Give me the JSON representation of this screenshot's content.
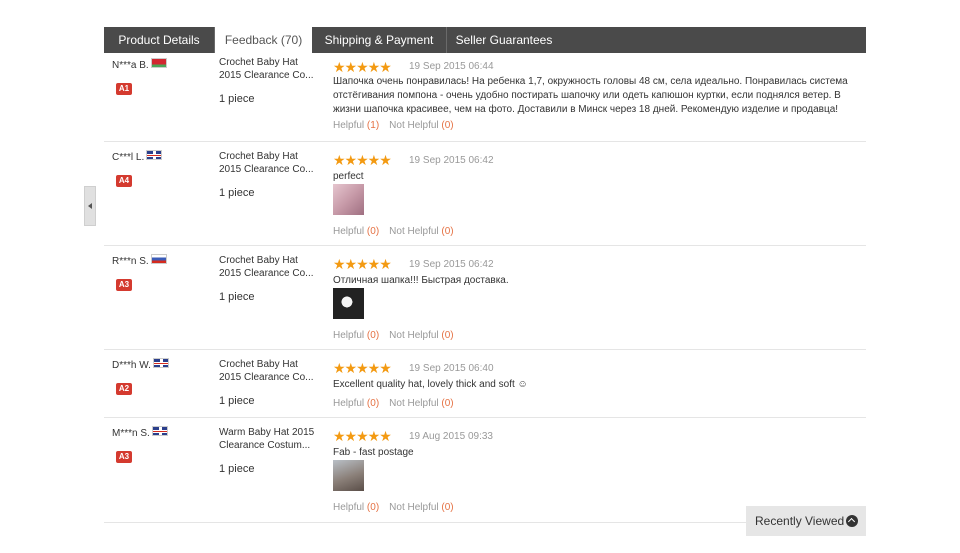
{
  "tabs": [
    {
      "label": "Product Details"
    },
    {
      "label": "Feedback (70)"
    },
    {
      "label": "Shipping & Payment"
    },
    {
      "label": "Seller Guarantees"
    }
  ],
  "reviews": [
    {
      "buyer": "N***a B.",
      "flag": "by",
      "level": "A1",
      "product": "Crochet Baby Hat 2015 Clearance Co...",
      "quantity": "1 piece",
      "stars": "★★★★★",
      "date": "19 Sep 2015 06:44",
      "text": "Шапочка очень понравилась! На ребенка 1,7, окружность головы 48 см, села идеально. Понравилась система отстёгивания помпона - очень удобно постирать шапочку или одеть капюшон куртки, если поднялся ветер. В жизни шапочка красивее, чем на фото. Доставили в Минск через 18 дней. Рекомендую изделие и продавца!",
      "helpful_label": "Helpful",
      "helpful_count": "(1)",
      "not_helpful_label": "Not Helpful",
      "not_helpful_count": "(0)"
    },
    {
      "buyer": "C***l L.",
      "flag": "gb",
      "level": "A4",
      "product": "Crochet Baby Hat 2015 Clearance Co...",
      "quantity": "1 piece",
      "stars": "★★★★★",
      "date": "19 Sep 2015 06:42",
      "text": "perfect",
      "helpful_label": "Helpful",
      "helpful_count": "(0)",
      "not_helpful_label": "Not Helpful",
      "not_helpful_count": "(0)"
    },
    {
      "buyer": "R***n S.",
      "flag": "ru",
      "level": "A3",
      "product": "Crochet Baby Hat 2015 Clearance Co...",
      "quantity": "1 piece",
      "stars": "★★★★★",
      "date": "19 Sep 2015 06:42",
      "text": "Отличная шапка!!! Быстрая доставка.",
      "helpful_label": "Helpful",
      "helpful_count": "(0)",
      "not_helpful_label": "Not Helpful",
      "not_helpful_count": "(0)"
    },
    {
      "buyer": "D***h W.",
      "flag": "gb",
      "level": "A2",
      "product": "Crochet Baby Hat 2015 Clearance Co...",
      "quantity": "1 piece",
      "stars": "★★★★★",
      "date": "19 Sep 2015 06:40",
      "text": "Excellent quality hat, lovely thick and soft ☺",
      "helpful_label": "Helpful",
      "helpful_count": "(0)",
      "not_helpful_label": "Not Helpful",
      "not_helpful_count": "(0)"
    },
    {
      "buyer": "M***n S.",
      "flag": "gb",
      "level": "A3",
      "product": "Warm Baby Hat 2015 Clearance Costum...",
      "quantity": "1 piece",
      "stars": "★★★★★",
      "date": "19 Aug 2015 09:33",
      "text": "Fab - fast postage",
      "helpful_label": "Helpful",
      "helpful_count": "(0)",
      "not_helpful_label": "Not Helpful",
      "not_helpful_count": "(0)"
    }
  ],
  "recently_viewed": {
    "label": "Recently Viewed",
    "icon": "chevron-up-circle-icon"
  },
  "colors": {
    "tab_bar": "#4a4a4a",
    "star": "#f39a12",
    "badge": "#d43a2f",
    "count": "#e57244"
  }
}
